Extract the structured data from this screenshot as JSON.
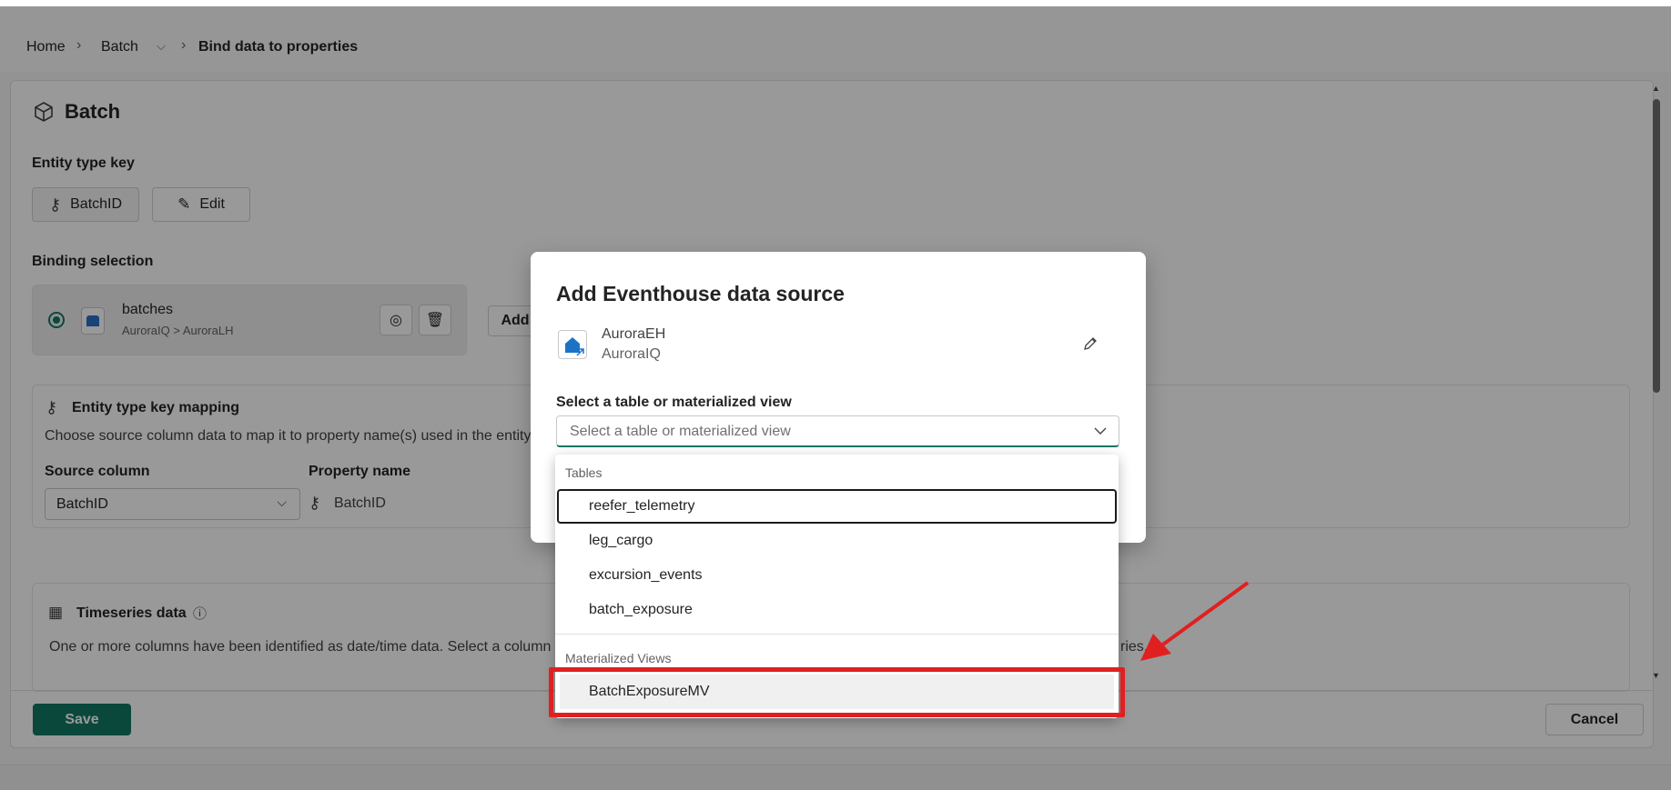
{
  "breadcrumb": {
    "home": "Home",
    "batch": "Batch",
    "current": "Bind data to properties"
  },
  "page": {
    "title": "Batch",
    "entity_key_label": "Entity type key",
    "entity_key_value": "BatchID",
    "edit_label": "Edit",
    "binding_label": "Binding selection",
    "binding_name": "batches",
    "binding_path": "AuroraIQ > AuroraLH",
    "add_label": "Add",
    "mapping_title": "Entity type key mapping",
    "mapping_desc": "Choose source column data to map it to property name(s) used in the entity t",
    "source_column_label": "Source column",
    "property_name_label": "Property name",
    "source_column_value": "BatchID",
    "property_name_value": "BatchID",
    "timeseries_title": "Timeseries data",
    "timeseries_desc_left": "One or more columns have been identified as date/time data. Select a column th",
    "timeseries_desc_right": "ries.",
    "save_label": "Save",
    "cancel_label": "Cancel"
  },
  "dialog": {
    "title": "Add Eventhouse data source",
    "source_name": "AuroraEH",
    "source_sub": "AuroraIQ",
    "select_label": "Select a table or materialized view",
    "select_placeholder": "Select a table or materialized view"
  },
  "dropdown": {
    "tables_label": "Tables",
    "tables": [
      "reefer_telemetry",
      "leg_cargo",
      "excursion_events",
      "batch_exposure"
    ],
    "views_label": "Materialized Views",
    "views": [
      "BatchExposureMV"
    ]
  },
  "colors": {
    "accent": "#117865",
    "annotation": "#e02020",
    "save_bg": "#117865"
  }
}
